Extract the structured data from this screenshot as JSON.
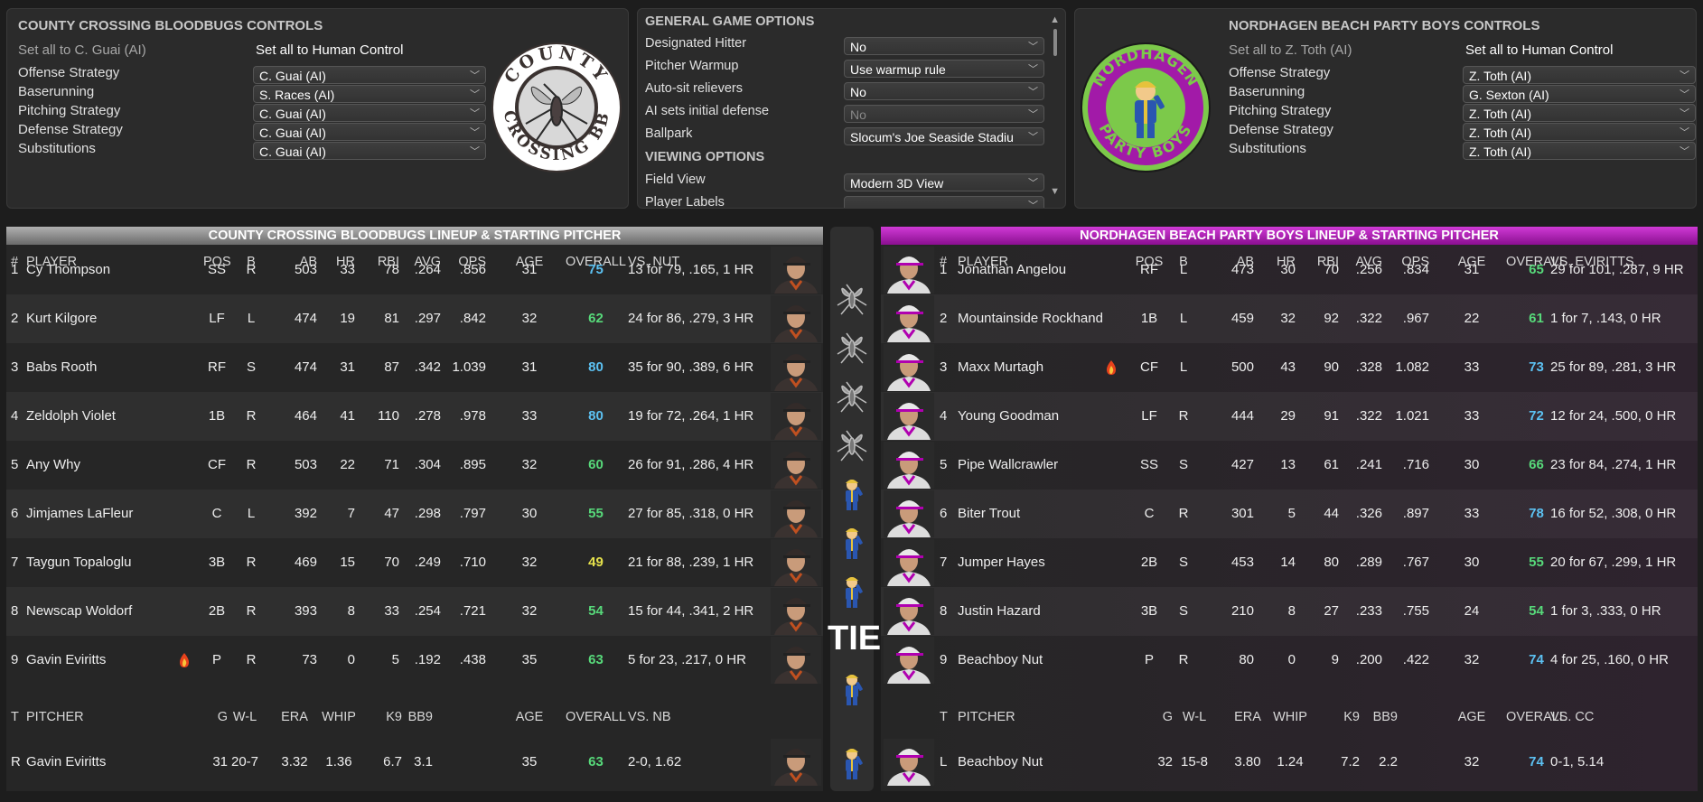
{
  "home_controls": {
    "title": "COUNTY CROSSING BLOODBUGS CONTROLS",
    "set_all_ai": "Set all to C. Guai (AI)",
    "set_all_human": "Set all to Human Control",
    "rows": [
      {
        "label": "Offense Strategy",
        "value": "C. Guai (AI)"
      },
      {
        "label": "Baserunning",
        "value": "S. Races (AI)"
      },
      {
        "label": "Pitching Strategy",
        "value": "C. Guai (AI)"
      },
      {
        "label": "Defense Strategy",
        "value": "C. Guai (AI)"
      },
      {
        "label": "Substitutions",
        "value": "C. Guai (AI)"
      }
    ],
    "logo_text": {
      "top": "COUNTY",
      "bottom": "CROSSING BB"
    }
  },
  "options": {
    "title": "GENERAL GAME OPTIONS",
    "rows": [
      {
        "label": "Designated Hitter",
        "value": "No",
        "disabled": false
      },
      {
        "label": "Pitcher Warmup",
        "value": "Use warmup rule",
        "disabled": false
      },
      {
        "label": "Auto-sit relievers",
        "value": "No",
        "disabled": false
      },
      {
        "label": "AI sets initial defense",
        "value": "No",
        "disabled": true
      },
      {
        "label": "Ballpark",
        "value": "Slocum's Joe Seaside Stadiu",
        "disabled": false
      }
    ],
    "viewing_title": "VIEWING OPTIONS",
    "viewing_rows": [
      {
        "label": "Field View",
        "value": "Modern 3D View"
      },
      {
        "label": "Player Labels",
        "value": ""
      }
    ]
  },
  "away_controls": {
    "title": "NORDHAGEN BEACH PARTY BOYS CONTROLS",
    "set_all_ai": "Set all to Z. Toth (AI)",
    "set_all_human": "Set all to Human Control",
    "rows": [
      {
        "label": "Offense Strategy",
        "value": "Z. Toth (AI)"
      },
      {
        "label": "Baserunning",
        "value": "G. Sexton (AI)"
      },
      {
        "label": "Pitching Strategy",
        "value": "Z. Toth (AI)"
      },
      {
        "label": "Defense Strategy",
        "value": "Z. Toth (AI)"
      },
      {
        "label": "Substitutions",
        "value": "Z. Toth (AI)"
      }
    ],
    "logo_text": {
      "top": "NORDHAGEN",
      "bottom": "PARTY BOYS"
    }
  },
  "home_lineup": {
    "title": "COUNTY CROSSING BLOODBUGS LINEUP & STARTING PITCHER",
    "headers": {
      "num": "#",
      "player": "PLAYER",
      "pos": "POS",
      "b": "B",
      "ab": "AB",
      "hr": "HR",
      "rbi": "RBI",
      "avg": "AVG",
      "ops": "OPS",
      "age": "AGE",
      "overall": "OVERALL",
      "vs": "VS. NUT"
    },
    "players": [
      {
        "num": "1",
        "name": "Cy Thompson",
        "pos": "SS",
        "b": "R",
        "ab": "503",
        "hr": "33",
        "rbi": "78",
        "avg": ".264",
        "ops": ".856",
        "age": "31",
        "overall": "75",
        "ov_color": "blue",
        "vs": "13 for 79, .165, 1 HR",
        "hot": false
      },
      {
        "num": "2",
        "name": "Kurt Kilgore",
        "pos": "LF",
        "b": "L",
        "ab": "474",
        "hr": "19",
        "rbi": "81",
        "avg": ".297",
        "ops": ".842",
        "age": "32",
        "overall": "62",
        "ov_color": "green",
        "vs": "24 for 86, .279, 3 HR",
        "hot": false
      },
      {
        "num": "3",
        "name": "Babs Rooth",
        "pos": "RF",
        "b": "S",
        "ab": "474",
        "hr": "31",
        "rbi": "87",
        "avg": ".342",
        "ops": "1.039",
        "age": "31",
        "overall": "80",
        "ov_color": "blue",
        "vs": "35 for 90, .389, 6 HR",
        "hot": false
      },
      {
        "num": "4",
        "name": "Zeldolph Violet",
        "pos": "1B",
        "b": "R",
        "ab": "464",
        "hr": "41",
        "rbi": "110",
        "avg": ".278",
        "ops": ".978",
        "age": "33",
        "overall": "80",
        "ov_color": "blue",
        "vs": "19 for 72, .264, 1 HR",
        "hot": false
      },
      {
        "num": "5",
        "name": "Any Why",
        "pos": "CF",
        "b": "R",
        "ab": "503",
        "hr": "22",
        "rbi": "71",
        "avg": ".304",
        "ops": ".895",
        "age": "32",
        "overall": "60",
        "ov_color": "green",
        "vs": "26 for 91, .286, 4 HR",
        "hot": false
      },
      {
        "num": "6",
        "name": "Jimjames LaFleur",
        "pos": "C",
        "b": "L",
        "ab": "392",
        "hr": "7",
        "rbi": "47",
        "avg": ".298",
        "ops": ".797",
        "age": "30",
        "overall": "55",
        "ov_color": "green",
        "vs": "27 for 85, .318, 0 HR",
        "hot": false
      },
      {
        "num": "7",
        "name": "Taygun Topaloglu",
        "pos": "3B",
        "b": "R",
        "ab": "469",
        "hr": "15",
        "rbi": "70",
        "avg": ".249",
        "ops": ".710",
        "age": "32",
        "overall": "49",
        "ov_color": "yellow",
        "vs": "21 for 88, .239, 1 HR",
        "hot": false
      },
      {
        "num": "8",
        "name": "Newscap Woldorf",
        "pos": "2B",
        "b": "R",
        "ab": "393",
        "hr": "8",
        "rbi": "33",
        "avg": ".254",
        "ops": ".721",
        "age": "32",
        "overall": "54",
        "ov_color": "green",
        "vs": "15 for 44, .341, 2 HR",
        "hot": false
      },
      {
        "num": "9",
        "name": "Gavin Eviritts",
        "pos": "P",
        "b": "R",
        "ab": "73",
        "hr": "0",
        "rbi": "5",
        "avg": ".192",
        "ops": ".438",
        "age": "35",
        "overall": "63",
        "ov_color": "green",
        "vs": "5 for 23, .217, 0 HR",
        "hot": true
      }
    ],
    "pitcher_headers": {
      "t": "T",
      "pitcher": "PITCHER",
      "g": "G",
      "wl": "W-L",
      "era": "ERA",
      "whip": "WHIP",
      "k9": "K9",
      "bb9": "BB9",
      "age": "AGE",
      "overall": "OVERALL",
      "vs": "VS. NB"
    },
    "pitcher": {
      "t": "R",
      "name": "Gavin Eviritts",
      "g": "31",
      "wl": "20-7",
      "era": "3.32",
      "whip": "1.36",
      "k9": "6.7",
      "bb9": "3.1",
      "age": "35",
      "overall": "63",
      "ov_color": "green",
      "vs": "2-0, 1.62"
    }
  },
  "away_lineup": {
    "title": "NORDHAGEN BEACH PARTY BOYS LINEUP & STARTING PITCHER",
    "headers": {
      "num": "#",
      "player": "PLAYER",
      "pos": "POS",
      "b": "B",
      "ab": "AB",
      "hr": "HR",
      "rbi": "RBI",
      "avg": "AVG",
      "ops": "OPS",
      "age": "AGE",
      "overall": "OVERALL",
      "vs": "VS. EVIRITTS"
    },
    "players": [
      {
        "num": "1",
        "name": "Jonathan Angelou",
        "pos": "RF",
        "b": "L",
        "ab": "473",
        "hr": "30",
        "rbi": "70",
        "avg": ".256",
        "ops": ".834",
        "age": "31",
        "overall": "65",
        "ov_color": "green",
        "vs": "29 for 101, .287, 9 HR",
        "hot": false
      },
      {
        "num": "2",
        "name": "Mountainside Rockhand",
        "pos": "1B",
        "b": "L",
        "ab": "459",
        "hr": "32",
        "rbi": "92",
        "avg": ".322",
        "ops": ".967",
        "age": "22",
        "overall": "61",
        "ov_color": "green",
        "vs": "1 for 7, .143, 0 HR",
        "hot": false
      },
      {
        "num": "3",
        "name": "Maxx Murtagh",
        "pos": "CF",
        "b": "L",
        "ab": "500",
        "hr": "43",
        "rbi": "90",
        "avg": ".328",
        "ops": "1.082",
        "age": "33",
        "overall": "73",
        "ov_color": "blue",
        "vs": "25 for 89, .281, 3 HR",
        "hot": true
      },
      {
        "num": "4",
        "name": "Young Goodman",
        "pos": "LF",
        "b": "R",
        "ab": "444",
        "hr": "29",
        "rbi": "91",
        "avg": ".322",
        "ops": "1.021",
        "age": "33",
        "overall": "72",
        "ov_color": "blue",
        "vs": "12 for 24, .500, 0 HR",
        "hot": false
      },
      {
        "num": "5",
        "name": "Pipe Wallcrawler",
        "pos": "SS",
        "b": "S",
        "ab": "427",
        "hr": "13",
        "rbi": "61",
        "avg": ".241",
        "ops": ".716",
        "age": "30",
        "overall": "66",
        "ov_color": "green",
        "vs": "23 for 84, .274, 1 HR",
        "hot": false
      },
      {
        "num": "6",
        "name": "Biter Trout",
        "pos": "C",
        "b": "R",
        "ab": "301",
        "hr": "5",
        "rbi": "44",
        "avg": ".326",
        "ops": ".897",
        "age": "33",
        "overall": "78",
        "ov_color": "blue",
        "vs": "16 for 52, .308, 0 HR",
        "hot": false
      },
      {
        "num": "7",
        "name": "Jumper Hayes",
        "pos": "2B",
        "b": "S",
        "ab": "453",
        "hr": "14",
        "rbi": "80",
        "avg": ".289",
        "ops": ".767",
        "age": "30",
        "overall": "55",
        "ov_color": "green",
        "vs": "20 for 67, .299, 1 HR",
        "hot": false
      },
      {
        "num": "8",
        "name": "Justin Hazard",
        "pos": "3B",
        "b": "S",
        "ab": "210",
        "hr": "8",
        "rbi": "27",
        "avg": ".233",
        "ops": ".755",
        "age": "24",
        "overall": "54",
        "ov_color": "green",
        "vs": "1 for 3, .333, 0 HR",
        "hot": false
      },
      {
        "num": "9",
        "name": "Beachboy Nut",
        "pos": "P",
        "b": "R",
        "ab": "80",
        "hr": "0",
        "rbi": "9",
        "avg": ".200",
        "ops": ".422",
        "age": "32",
        "overall": "74",
        "ov_color": "blue",
        "vs": "4 for 25, .160, 0 HR",
        "hot": false
      }
    ],
    "pitcher_headers": {
      "t": "T",
      "pitcher": "PITCHER",
      "g": "G",
      "wl": "W-L",
      "era": "ERA",
      "whip": "WHIP",
      "k9": "K9",
      "bb9": "BB9",
      "age": "AGE",
      "overall": "OVERALL",
      "vs": "VS. CC"
    },
    "pitcher": {
      "t": "L",
      "name": "Beachboy Nut",
      "g": "32",
      "wl": "15-8",
      "era": "3.80",
      "whip": "1.24",
      "k9": "7.2",
      "bb9": "2.2",
      "age": "32",
      "overall": "74",
      "ov_color": "blue",
      "vs": "0-1, 5.14"
    }
  },
  "matchup": {
    "edge_icons": [
      "mosquito-icon",
      "mosquito-icon",
      "mosquito-icon",
      "mosquito-icon",
      "vault-boy-icon",
      "vault-boy-icon",
      "vault-boy-icon",
      "tie",
      "vault-boy-icon",
      "vault-boy-icon"
    ],
    "tie_label": "TIE"
  },
  "colors": {
    "home_accent": "#8c8c8c",
    "away_accent": "#b000b0",
    "ov_blue": "#5cc1f2",
    "ov_green": "#57d97a",
    "ov_yellow": "#e6e24c"
  }
}
